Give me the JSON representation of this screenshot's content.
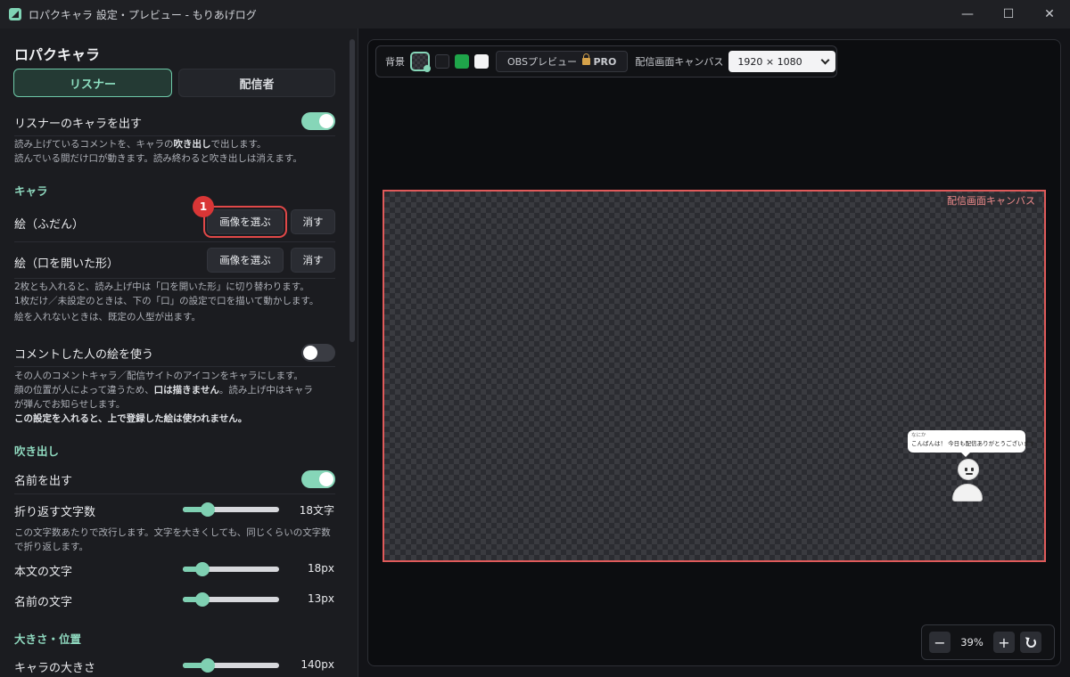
{
  "window": {
    "title": "ロパクキャラ 設定・プレビュー - もりあげログ",
    "minimize": "—",
    "maximize": "☐",
    "close": "✕"
  },
  "panel": {
    "title": "ロパクキャラ",
    "tabs": [
      {
        "label": "リスナー",
        "active": true
      },
      {
        "label": "配信者",
        "active": false
      }
    ]
  },
  "listener_chara": {
    "label": "リスナーのキャラを出す",
    "enabled": true,
    "desc_1_pre": "読み上げているコメントを、キャラの",
    "desc_1_bold": "吹き出し",
    "desc_1_post": "で出します。",
    "desc_2": "読んでいる間だけ口が動きます。読み終わると吹き出しは消えます。"
  },
  "chara_section": {
    "title": "キャラ",
    "normal_label": "絵（ふだん）",
    "open_label": "絵（口を開いた形）",
    "choose_image": "画像を選ぶ",
    "clear": "消す",
    "step_badge": "1",
    "desc_1": "2枚とも入れると、読み上げ中は「口を開いた形」に切り替わります。",
    "desc_2": "1枚だけ／未設定のときは、下の「口」の設定で口を描いて動かします。",
    "desc_3": "絵を入れないときは、既定の人型が出ます。"
  },
  "commenter_image": {
    "label": "コメントした人の絵を使う",
    "enabled": false,
    "desc_1": "その人のコメントキャラ／配信サイトのアイコンをキャラにします。",
    "desc_2_pre": "顔の位置が人によって違うため、",
    "desc_2_bold": "口は描きません",
    "desc_2_post": "。読み上げ中はキャラ",
    "desc_3": "が弾んでお知らせします。",
    "desc_4": "この設定を入れると、上で登録した絵は使われません。"
  },
  "bubble_section": {
    "title": "吹き出し",
    "show_name_label": "名前を出す",
    "show_name_enabled": true,
    "wrap_label": "折り返す文字数",
    "wrap_value": "18文字",
    "wrap_fraction": 0.26,
    "wrap_desc_1": "この文字数あたりで改行します。文字を大きくしても、同じくらいの文字数",
    "wrap_desc_2": "で折り返します。",
    "body_font_label": "本文の文字",
    "body_font_value": "18px",
    "body_font_fraction": 0.2,
    "name_font_label": "名前の文字",
    "name_font_value": "13px",
    "name_font_fraction": 0.2
  },
  "size_section": {
    "title": "大きさ・位置",
    "chara_size_label": "キャラの大きさ",
    "chara_size_value": "140px",
    "chara_size_fraction": 0.26
  },
  "toolbar": {
    "bg_label": "背景",
    "obs_preview": "OBSプレビュー",
    "pro": "PRO",
    "canvas_label": "配信画面キャンバス",
    "canvas_size": "1920 × 1080",
    "swatch_green": "#1fa54a",
    "swatch_white": "#f4f4f5",
    "swatch_black": "#1a1b1f"
  },
  "preview": {
    "canvas_tag": "配信画面キャンバス",
    "bubble_name": "なにか",
    "bubble_text": "こんばんは！ 今日も配信ありがとうございます"
  },
  "zoom": {
    "minus": "−",
    "value": "39%",
    "plus": "+"
  },
  "colors": {
    "accent": "#86d6b8",
    "highlight": "#e04848",
    "canvas_border": "#e05a5a"
  }
}
